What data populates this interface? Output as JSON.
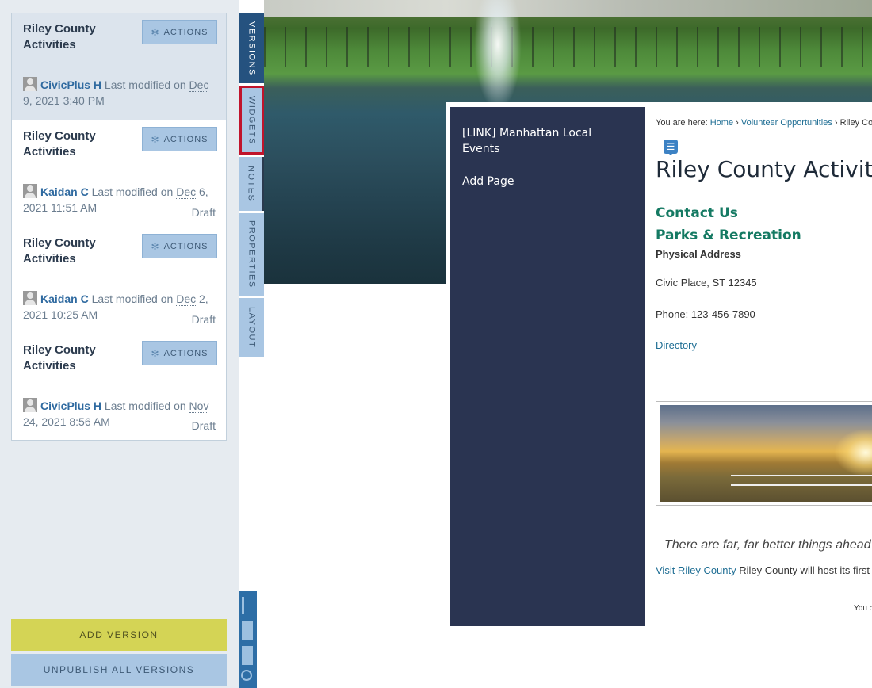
{
  "versions": {
    "items": [
      {
        "title": "Riley County Activities",
        "actions_label": "ACTIONS",
        "author": "CivicPlus H",
        "modified_label": "Last modified on",
        "date_abbr": "Dec",
        "date_rest": " 9, 2021 3:40 PM",
        "status": ""
      },
      {
        "title": "Riley County Activities",
        "actions_label": "ACTIONS",
        "author": "Kaidan C",
        "modified_label": "Last modified on",
        "date_abbr": "Dec",
        "date_rest": " 6, 2021 11:51 AM",
        "status": "Draft"
      },
      {
        "title": "Riley County Activities",
        "actions_label": "ACTIONS",
        "author": "Kaidan C",
        "modified_label": "Last modified on",
        "date_abbr": "Dec",
        "date_rest": " 2, 2021 10:25 AM",
        "status": "Draft"
      },
      {
        "title": "Riley County Activities",
        "actions_label": "ACTIONS",
        "author": "CivicPlus H",
        "modified_label": "Last modified on",
        "date_abbr": "Nov",
        "date_rest": " 24, 2021 8:56 AM",
        "status": "Draft"
      }
    ],
    "add_version_label": "ADD VERSION",
    "unpublish_label": "UNPUBLISH ALL VERSIONS"
  },
  "tabs": {
    "versions": "VERSIONS",
    "widgets": "WIDGETS",
    "notes": "NOTES",
    "properties": "PROPERTIES",
    "layout": "LAYOUT"
  },
  "site_nav": {
    "link1": "[LINK] Manhattan Local Events",
    "link2": "Add Page"
  },
  "content": {
    "breadcrumb_prefix": "You are here:",
    "crumb_home": "Home",
    "crumb_sep": "›",
    "crumb_volunteer": "Volunteer Opportunities",
    "crumb_current": "Riley Co",
    "title": "Riley County Activit",
    "contact_heading": "Contact Us",
    "dept_heading": "Parks & Recreation",
    "address_label": "Physical Address",
    "address": "Civic Place, ST 12345",
    "phone": "Phone: 123-456-7890",
    "directory_link": "Directory",
    "quote": "There are far, far better things ahead t",
    "visit_link": "Visit Riley County",
    "visit_text": " Riley County will host its first",
    "tiny_text": "You c"
  },
  "colors": {
    "accent_blue": "#25527f",
    "highlight_red": "#c0142c",
    "add_version_yellow": "#d4d455",
    "nav_dark": "#2a3451",
    "heading_green": "#157a63"
  }
}
